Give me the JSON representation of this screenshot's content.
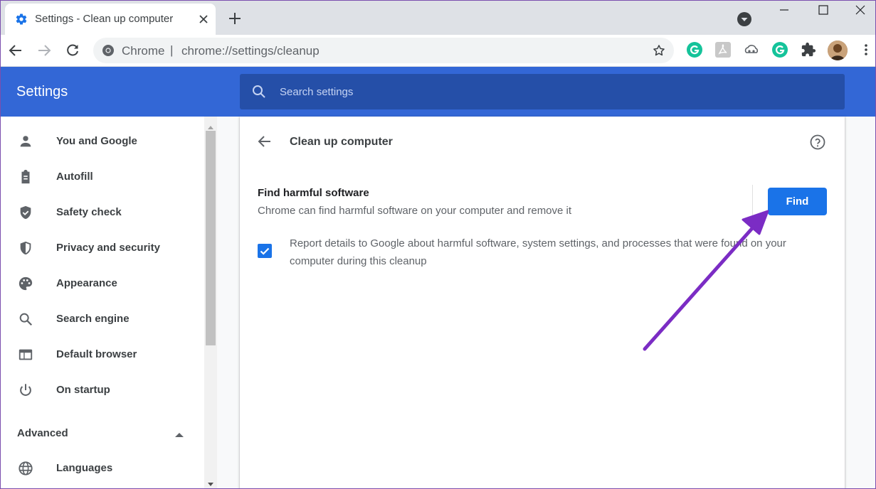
{
  "browser": {
    "tab_title": "Settings - Clean up computer",
    "omnibox": {
      "origin": "Chrome",
      "separator": "|",
      "url": "chrome://settings/cleanup"
    }
  },
  "settings": {
    "title": "Settings",
    "search_placeholder": "Search settings"
  },
  "sidebar": {
    "items": [
      {
        "label": "You and Google",
        "icon": "person-icon"
      },
      {
        "label": "Autofill",
        "icon": "clipboard-icon"
      },
      {
        "label": "Safety check",
        "icon": "shield-check-icon"
      },
      {
        "label": "Privacy and security",
        "icon": "shield-half-icon"
      },
      {
        "label": "Appearance",
        "icon": "palette-icon"
      },
      {
        "label": "Search engine",
        "icon": "search-icon"
      },
      {
        "label": "Default browser",
        "icon": "browser-icon"
      },
      {
        "label": "On startup",
        "icon": "power-icon"
      }
    ],
    "advanced_label": "Advanced",
    "languages_label": "Languages"
  },
  "content": {
    "page_title": "Clean up computer",
    "find_title": "Find harmful software",
    "find_description": "Chrome can find harmful software on your computer and remove it",
    "find_button": "Find",
    "report_label": "Report details to Google about harmful software, system settings, and processes that were found on your computer during this cleanup",
    "report_checked": true
  },
  "colors": {
    "header_blue": "#3367d6",
    "search_blue": "#254fa8",
    "button_blue": "#1a73e8",
    "annotation_arrow": "#7b2cc4"
  }
}
